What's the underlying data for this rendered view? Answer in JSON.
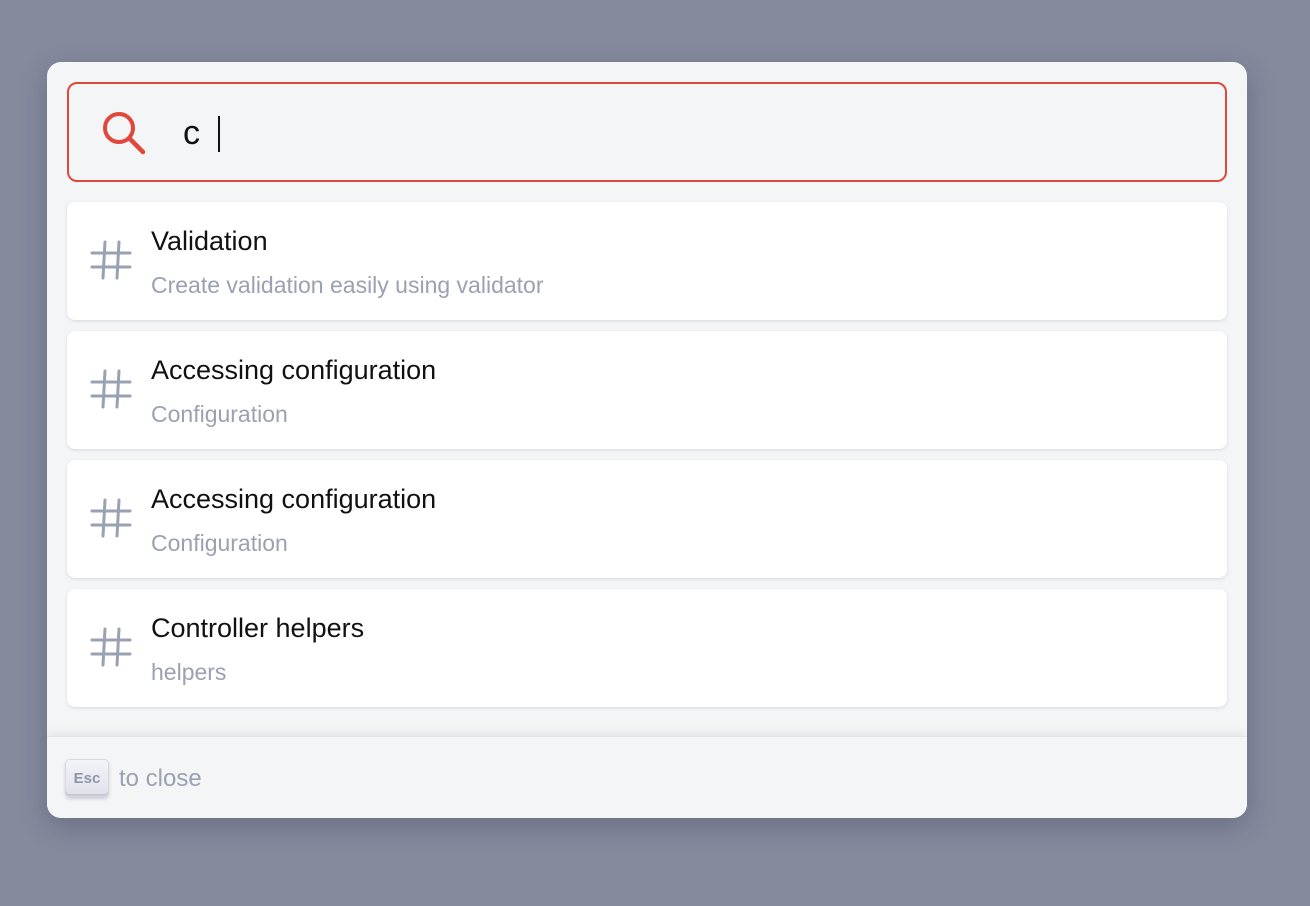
{
  "search": {
    "value": "c",
    "icon": "search-icon",
    "accent_color": "#e0483b"
  },
  "results": [
    {
      "title": "Validation",
      "subtitle": "Create validation easily using validator",
      "icon": "hash-icon"
    },
    {
      "title": "Accessing configuration",
      "subtitle": "Configuration",
      "icon": "hash-icon"
    },
    {
      "title": "Accessing configuration",
      "subtitle": "Configuration",
      "icon": "hash-icon"
    },
    {
      "title": "Controller helpers",
      "subtitle": "helpers",
      "icon": "hash-icon"
    }
  ],
  "footer": {
    "key_label": "Esc",
    "text": "to close"
  }
}
